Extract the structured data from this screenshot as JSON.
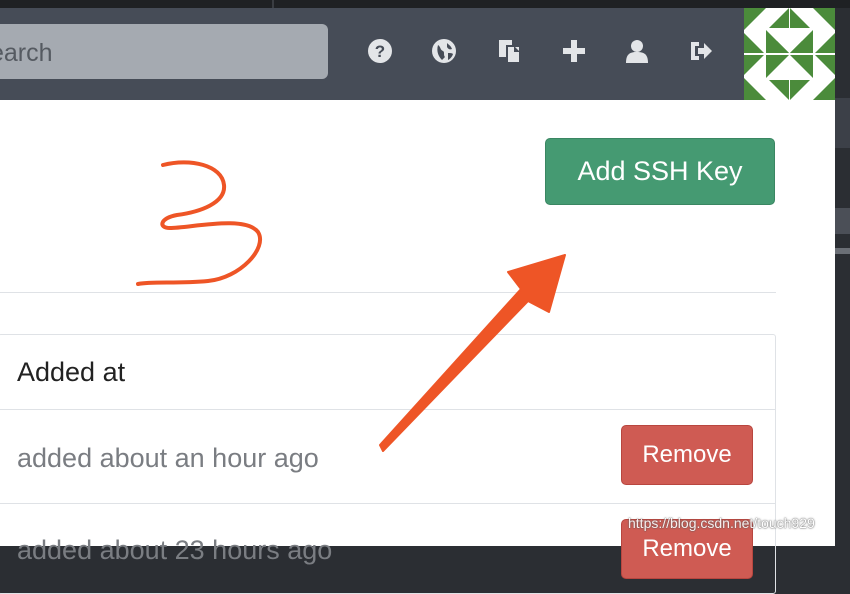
{
  "navbar": {
    "search_placeholder_visible": "earch",
    "icons": [
      "help-icon",
      "explore-icon",
      "snippets-icon",
      "plus-icon",
      "user-icon",
      "sign-out-icon"
    ]
  },
  "content": {
    "add_ssh_key_label": "Add SSH Key",
    "table": {
      "header": "Added at",
      "rows": [
        {
          "added": "added about an hour ago",
          "action": "Remove"
        },
        {
          "added": "added about 23 hours ago",
          "action": "Remove"
        }
      ]
    }
  },
  "annotation": {
    "number": "3"
  },
  "watermark": "https://blog.csdn.net/touch929",
  "colors": {
    "navbar": "#464c57",
    "add_button": "#459a72",
    "remove_button": "#cf5b53",
    "annotation": "#ee5526"
  }
}
